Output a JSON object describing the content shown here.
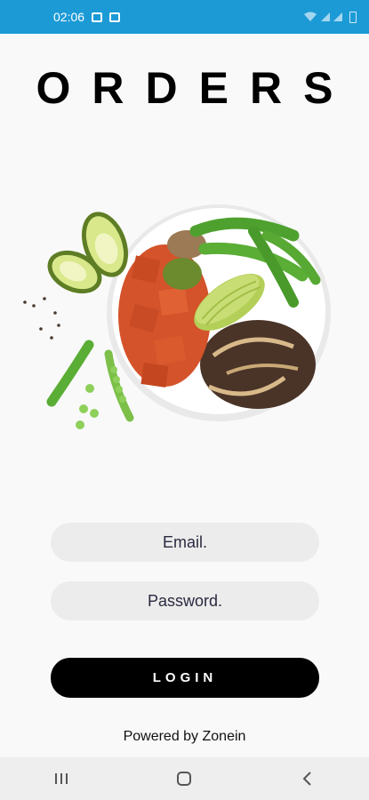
{
  "status_bar": {
    "time": "02:06",
    "icons": [
      "gallery-icon",
      "notification-icon",
      "wifi-icon",
      "signal-icon",
      "battery-icon"
    ]
  },
  "app": {
    "title": "ORDERS",
    "hero_image": "poke-bowl-image"
  },
  "form": {
    "email_placeholder": "Email.",
    "password_placeholder": "Password.",
    "login_label": "LOGIN"
  },
  "footer": {
    "powered_by": "Powered by Zonein"
  },
  "nav": {
    "icons": [
      "recent-apps-icon",
      "home-icon",
      "back-icon"
    ]
  },
  "colors": {
    "status_bar": "#1c9ad6",
    "button": "#000000",
    "field": "#ececec"
  }
}
